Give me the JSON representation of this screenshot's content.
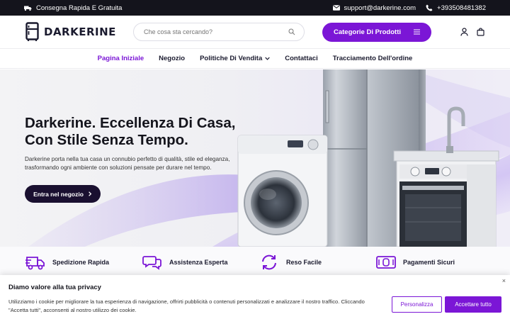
{
  "topbar": {
    "shipping": "Consegna Rapida E Gratuita",
    "email": "support@darkerine.com",
    "phone": "+393508481382"
  },
  "header": {
    "logo": "DARKERINE",
    "search_placeholder": "Che cosa sta cercando?",
    "categories_label": "Categorie Di Prodotti"
  },
  "nav": [
    {
      "label": "Pagina Iniziale",
      "active": true
    },
    {
      "label": "Negozio"
    },
    {
      "label": "Politiche Di Vendita",
      "dropdown": true
    },
    {
      "label": "Contattaci"
    },
    {
      "label": "Tracciamento Dell'ordine"
    }
  ],
  "hero": {
    "title": "Darkerine. Eccellenza Di Casa, Con Stile Senza Tempo.",
    "subtitle": "Darkerine porta nella tua casa un connubio perfetto di qualità, stile ed eleganza, trasformando ogni ambiente con soluzioni pensate per durare nel tempo.",
    "cta": "Entra nel negozio"
  },
  "features": [
    {
      "label": "Spedizione Rapida",
      "icon": "truck-icon"
    },
    {
      "label": "Assistenza Esperta",
      "icon": "chat-icon"
    },
    {
      "label": "Reso Facile",
      "icon": "refresh-icon"
    },
    {
      "label": "Pagamenti Sicuri",
      "icon": "money-icon"
    }
  ],
  "cookie": {
    "title": "Diamo valore alla tua privacy",
    "text": "Utilizziamo i cookie per migliorare la tua esperienza di navigazione, offrirti pubblicità o contenuti personalizzati e analizzare il nostro traffico. Cliccando \"Accetta tutti\", acconsenti al nostro utilizzo dei cookie.",
    "customize": "Personalizza",
    "accept": "Accettare tutto",
    "close": "×"
  },
  "colors": {
    "accent": "#7b16d6",
    "dark": "#14141c"
  }
}
